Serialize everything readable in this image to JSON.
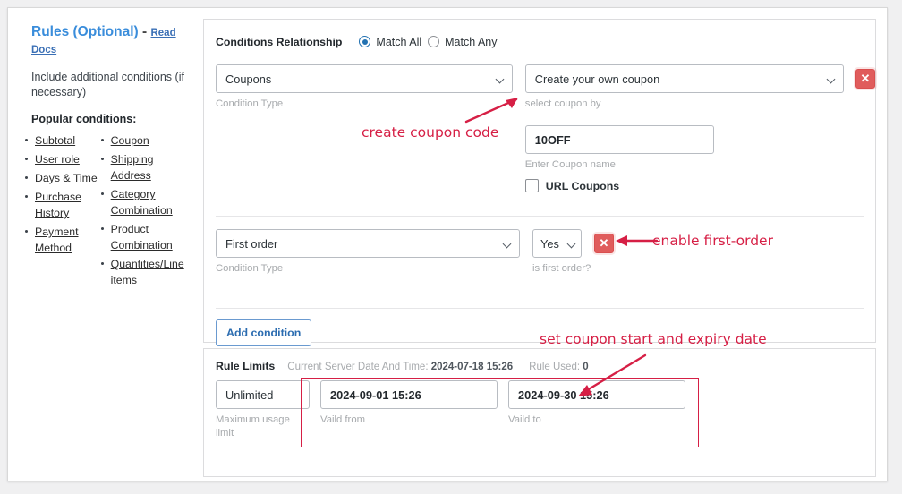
{
  "sidebar": {
    "title": "Rules (Optional)",
    "dash": " - ",
    "read_docs": "Read Docs",
    "description": "Include additional conditions (if necessary)",
    "popular_heading": "Popular conditions:",
    "column1": [
      {
        "label": "Subtotal",
        "link": true
      },
      {
        "label": "User role",
        "link": true
      },
      {
        "label": "Days & Time",
        "link": false
      },
      {
        "label": "Purchase History",
        "link": true
      },
      {
        "label": "Payment Method",
        "link": true
      }
    ],
    "column2": [
      {
        "label": "Coupon",
        "link": true
      },
      {
        "label": "Shipping Address",
        "link": true
      },
      {
        "label": "Category Combination",
        "link": true
      },
      {
        "label": "Product Combination",
        "link": true
      },
      {
        "label": "Quantities/Line items",
        "link": true
      }
    ]
  },
  "conditions": {
    "relationship_label": "Conditions Relationship",
    "match_all_label": "Match All",
    "match_any_label": "Match Any",
    "match_selected": "Match All",
    "row1": {
      "condition_type_value": "Coupons",
      "condition_type_hint": "Condition Type",
      "coupon_by_value": "Create your own coupon",
      "coupon_by_hint": "select coupon by",
      "coupon_name_value": "10OFF",
      "coupon_name_hint": "Enter Coupon name",
      "url_coupons_label": "URL Coupons",
      "url_coupons_checked": false,
      "delete_label": "✕"
    },
    "row2": {
      "condition_type_value": "First order",
      "condition_type_hint": "Condition Type",
      "is_first_order_value": "Yes",
      "is_first_order_hint": "is first order?",
      "delete_label": "✕"
    },
    "add_condition_label": "Add condition"
  },
  "rule_limits": {
    "title": "Rule Limits",
    "server_time_label": "Current Server Date And Time:",
    "server_time_value": "2024-07-18 15:26",
    "rule_used_label": "Rule Used:",
    "rule_used_value": "0",
    "max_usage_value": "Unlimited",
    "max_usage_hint": "Maximum usage limit",
    "valid_from_value": "2024-09-01 15:26",
    "valid_from_hint": "Vaild from",
    "valid_to_value": "2024-09-30 15:26",
    "valid_to_hint": "Vaild to"
  },
  "annotations": {
    "create_coupon_code": "create coupon code",
    "enable_first_order": "enable first-order",
    "set_dates": "set coupon start and expiry date",
    "color": "#d61f45"
  }
}
